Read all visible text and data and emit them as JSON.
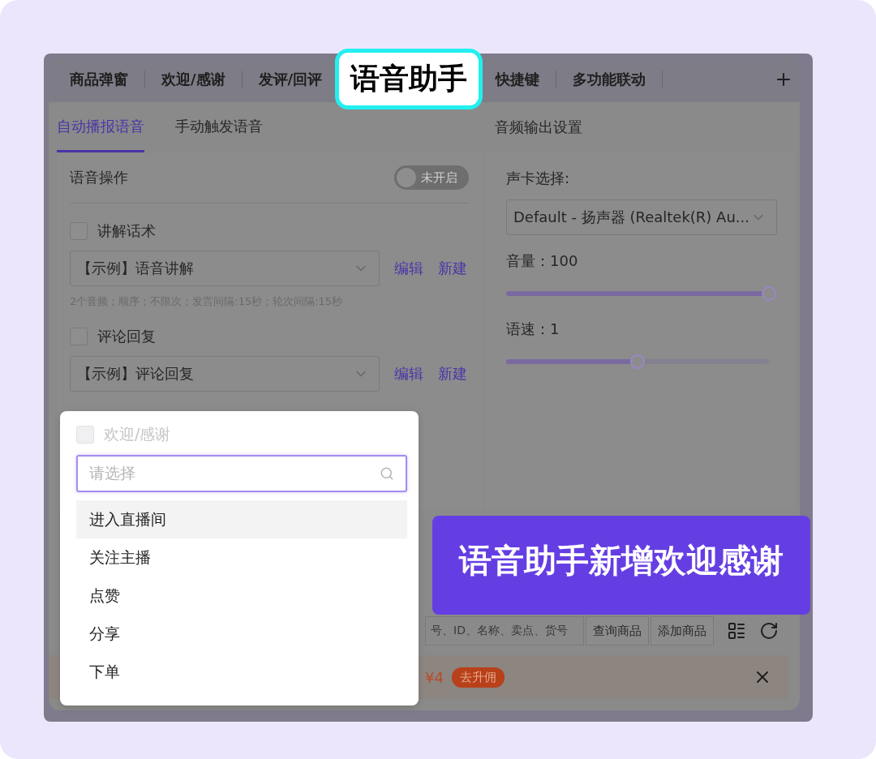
{
  "tabs": [
    {
      "label": "商品弹窗",
      "selected": false
    },
    {
      "label": "欢迎/感谢",
      "selected": false
    },
    {
      "label": "发评/回评",
      "selected": false
    },
    {
      "label": "语音助手",
      "selected": true
    },
    {
      "label": "快捷键",
      "selected": false
    },
    {
      "label": "多功能联动",
      "selected": false
    }
  ],
  "subtabs": [
    {
      "label": "自动播报语音",
      "selected": true
    },
    {
      "label": "手动触发语音",
      "selected": false
    }
  ],
  "voice_panel": {
    "title": "语音操作",
    "toggle": {
      "on": false,
      "label": "未开启"
    },
    "groups": [
      {
        "label": "讲解话术",
        "checked": false,
        "select": "【示例】语音讲解",
        "actions": [
          "编辑",
          "新建"
        ],
        "hint": "2个音频；顺序；不限次；发言间隔:15秒；轮次间隔:15秒"
      },
      {
        "label": "评论回复",
        "checked": false,
        "select": "【示例】评论回复",
        "actions": [
          "编辑",
          "新建"
        ]
      }
    ]
  },
  "audio_panel": {
    "title": "音频输出设置",
    "card_label": "声卡选择:",
    "card_select": "Default - 扬声器 (Realtek(R) Au...",
    "sliders": [
      {
        "label": "音量：100",
        "level": 1
      },
      {
        "label": "语速：1",
        "level": 0.5
      }
    ]
  },
  "product_bar": {
    "search_text": "号、ID、名称、卖点、货号",
    "buttons": [
      "查询商品",
      "添加商品"
    ]
  },
  "banner": {
    "text": "¥4",
    "badge": "去升佣"
  },
  "dropdown": {
    "checkbox": {
      "label": "欢迎/感谢",
      "checked": false,
      "disabled": true
    },
    "search": {
      "placeholder": "请选择"
    },
    "options": [
      {
        "label": "进入直播间",
        "selected": true
      },
      {
        "label": "关注主播",
        "selected": false
      },
      {
        "label": "点赞",
        "selected": false
      },
      {
        "label": "分享",
        "selected": false
      },
      {
        "label": "下单",
        "selected": false
      }
    ]
  },
  "callout": "语音助手新增欢迎感谢"
}
